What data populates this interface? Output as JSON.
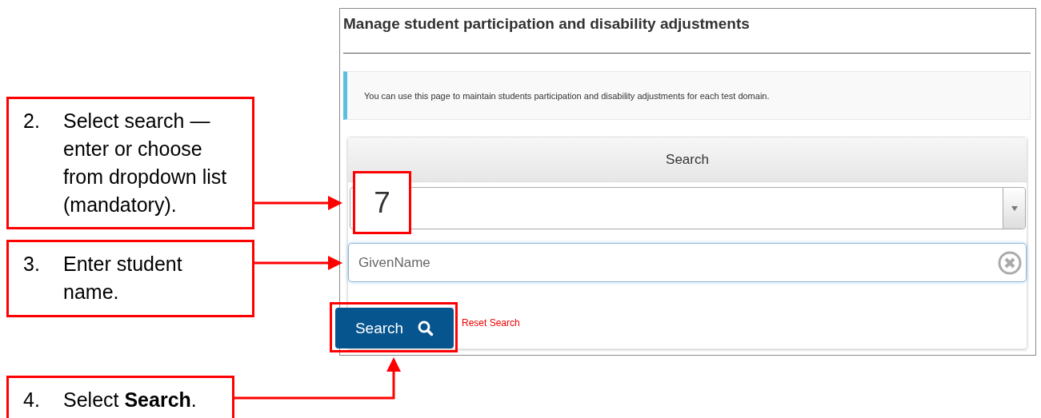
{
  "callouts": [
    {
      "number": "2.",
      "text": "Select search — enter or choose from dropdown list (mandatory)."
    },
    {
      "number": "3.",
      "text": "Enter student name."
    },
    {
      "number": "4.",
      "text": "Select **Search**."
    }
  ],
  "page": {
    "title": "Manage student participation and disability adjustments",
    "info": "You can use this page to maintain students participation and disability adjustments for each test domain.",
    "search_panel": {
      "heading": "Search",
      "step_marker": "7",
      "name_field": {
        "placeholder": "GivenName"
      },
      "search_button": "Search",
      "reset_link": "Reset Search"
    }
  }
}
